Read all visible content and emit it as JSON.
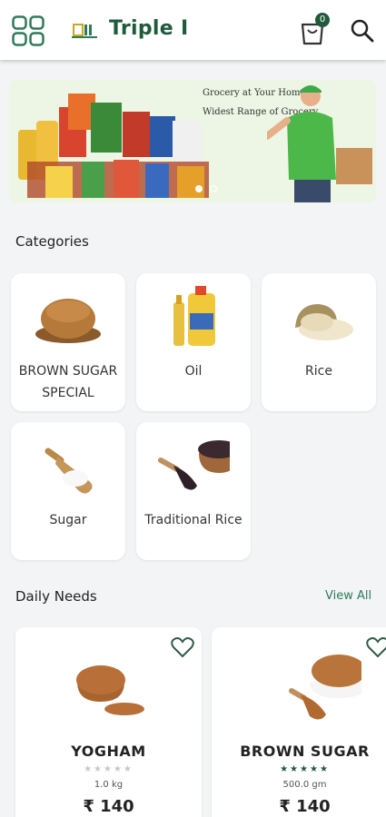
{
  "header": {
    "brand": "Triple I",
    "cart_count": "0",
    "brand_color": "#1f5a3a"
  },
  "banner": {
    "line1": "Grocery at Your Home",
    "line2": "Widest Range of Grocery",
    "slide_count": 2,
    "active_slide": 1
  },
  "categories": {
    "title": "Categories",
    "items": [
      {
        "label": "BROWN SUGAR SPECIAL"
      },
      {
        "label": "Oil"
      },
      {
        "label": "Rice"
      },
      {
        "label": "Sugar"
      },
      {
        "label": "Traditional Rice"
      }
    ]
  },
  "daily_needs": {
    "title": "Daily Needs",
    "view_all": "View All",
    "products": [
      {
        "name": "YOGHAM",
        "stars": "★★★★★",
        "rating_filled": false,
        "weight": "1.0 kg",
        "price": "₹ 140"
      },
      {
        "name": "BROWN SUGAR",
        "stars": "★★★★★",
        "rating_filled": true,
        "weight": "500.0 gm",
        "price": "₹ 140"
      }
    ]
  }
}
